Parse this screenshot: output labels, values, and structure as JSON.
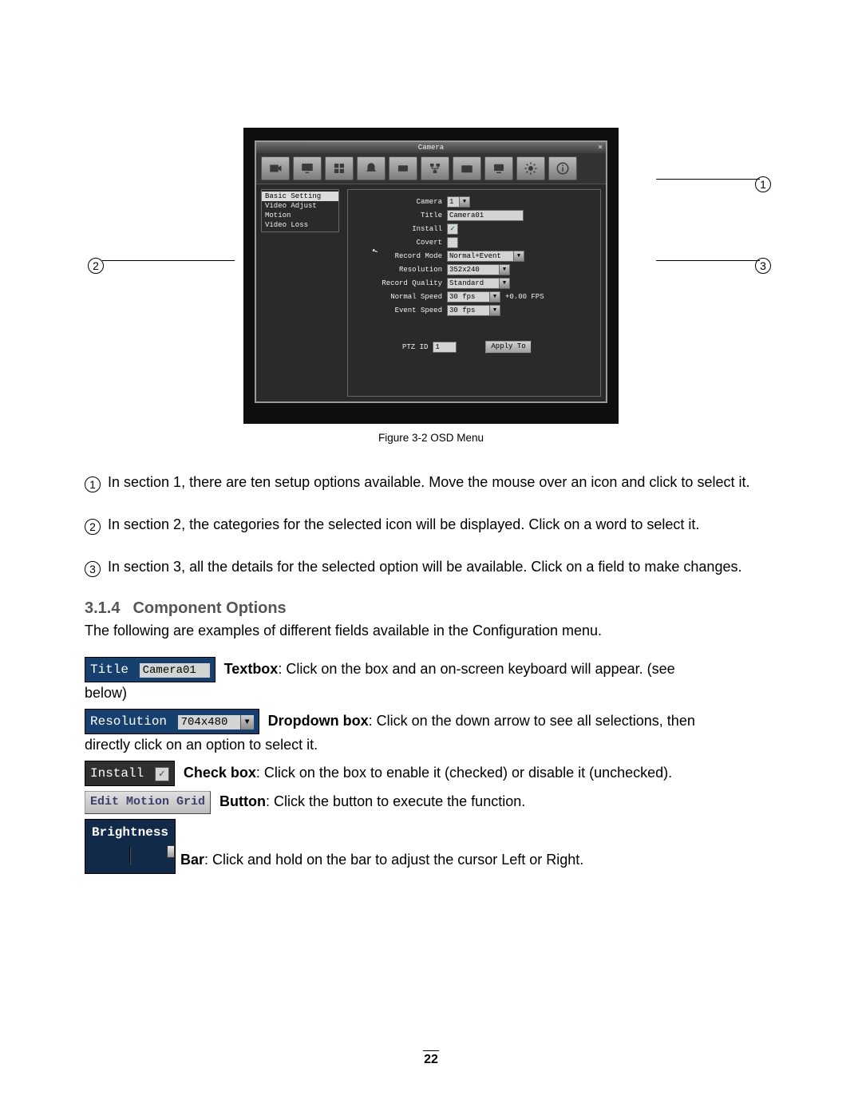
{
  "figure": {
    "window_title": "Camera",
    "toolbar_icons": [
      "camera-icon",
      "monitor-icon",
      "record-icon",
      "alarm-icon",
      "disk-icon",
      "network-icon",
      "info-icon",
      "display-icon",
      "system-icon",
      "help-icon"
    ],
    "sidebar": [
      {
        "label": "Basic Setting",
        "active": true
      },
      {
        "label": "Video Adjust",
        "active": false
      },
      {
        "label": "Motion",
        "active": false
      },
      {
        "label": "Video Loss",
        "active": false
      }
    ],
    "fields": {
      "camera_label": "Camera",
      "camera_value": "1",
      "title_label": "Title",
      "title_value": "Camera01",
      "install_label": "Install",
      "install_checked": true,
      "covert_label": "Covert",
      "covert_checked": false,
      "record_mode_label": "Record Mode",
      "record_mode_value": "Normal+Event",
      "resolution_label": "Resolution",
      "resolution_value": "352x240",
      "record_quality_label": "Record Quality",
      "record_quality_value": "Standard",
      "normal_speed_label": "Normal Speed",
      "normal_speed_value": "30 fps",
      "normal_speed_extra": "+0.00 FPS",
      "event_speed_label": "Event Speed",
      "event_speed_value": "30 fps",
      "ptz_id_label": "PTZ ID",
      "ptz_id_value": "1",
      "apply_to_label": "Apply To"
    },
    "callouts": {
      "one": "1",
      "two": "2",
      "three": "3"
    },
    "caption": "Figure 3-2 OSD Menu"
  },
  "paragraphs": {
    "p1": "In section 1, there are ten setup options available. Move the mouse over an icon and click to select it.",
    "p2": "In section 2, the categories for the selected icon will be displayed. Click on a word to select it.",
    "p3": "In section 3, all the details for the selected option will be available. Click on a field to make changes."
  },
  "section": {
    "number": "3.1.4",
    "title": "Component Options",
    "intro": "The following are examples of different fields available in the Configuration menu."
  },
  "examples": {
    "textbox": {
      "snippet_label": "Title",
      "snippet_value": "Camera01",
      "term": "Textbox",
      "desc_a": ": Click on the box and an on-screen keyboard will appear. (see",
      "desc_b": "below)"
    },
    "dropdown": {
      "snippet_label": "Resolution",
      "snippet_value": "704x480",
      "term": "Dropdown box",
      "desc_a": ": Click on the down arrow to see all selections, then",
      "desc_b": "directly click on an option to select it."
    },
    "checkbox": {
      "snippet_label": "Install",
      "term": "Check box",
      "desc": ": Click on the box to enable it (checked) or disable it (unchecked)."
    },
    "button": {
      "snippet_label": "Edit Motion Grid",
      "term": "Button",
      "desc": ": Click the button to execute the function."
    },
    "bar": {
      "snippet_label": "Brightness",
      "term": "Bar",
      "desc": ": Click and hold on the bar to adjust the cursor Left or Right."
    }
  },
  "page_number": "22"
}
